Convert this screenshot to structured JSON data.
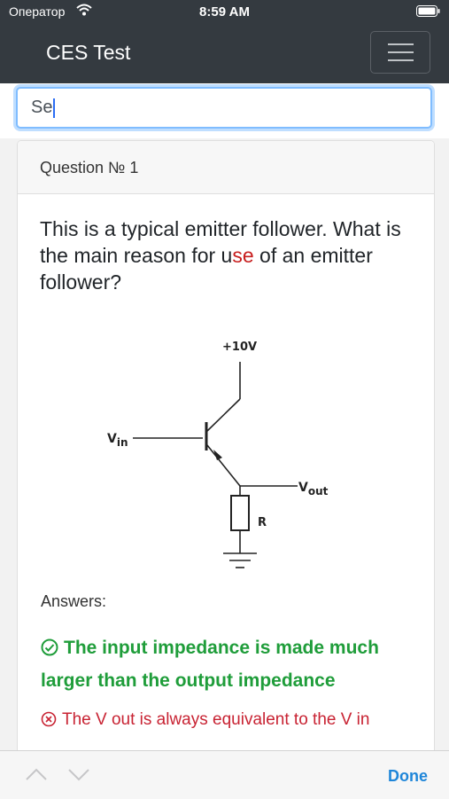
{
  "status_bar": {
    "carrier": "Оператор",
    "time": "8:59 AM"
  },
  "navbar": {
    "brand": "CES Test"
  },
  "search": {
    "value": "Se"
  },
  "question": {
    "header": "Question № 1",
    "text_before": "This is a typical emitter follower. What is the main reason for u",
    "highlight": "se",
    "text_after": " of an emitter follower?"
  },
  "figure": {
    "supply": "+10V",
    "vin_main": "V",
    "vin_sub": "in",
    "vout_main": "V",
    "vout_sub": "out",
    "resistor": "R"
  },
  "answers": {
    "label": "Answers:",
    "correct": "The input impedance is made much larger than the output impedance",
    "wrong": "The V out is always equivalent to the V in"
  },
  "accessory": {
    "done": "Done"
  },
  "colors": {
    "highlight": "#c71d1d",
    "correct": "#1f9d3a",
    "wrong": "#c82333",
    "accent": "#1f86d9"
  }
}
